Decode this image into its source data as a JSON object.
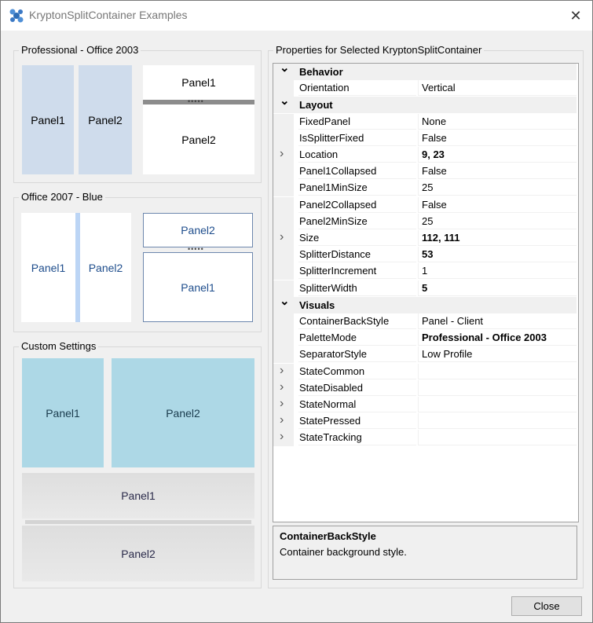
{
  "window": {
    "title": "KryptonSplitContainer Examples"
  },
  "groups": {
    "professional": {
      "title": "Professional - Office 2003",
      "vertical_panel1": "Panel1",
      "vertical_panel2": "Panel2",
      "horizontal_panel1": "Panel1",
      "horizontal_panel2": "Panel2"
    },
    "office2007": {
      "title": "Office 2007 - Blue",
      "vertical_panel1": "Panel1",
      "vertical_panel2": "Panel2",
      "horizontal_panel1": "Panel2",
      "horizontal_panel2": "Panel1"
    },
    "custom": {
      "title": "Custom Settings",
      "top_panel1": "Panel1",
      "top_panel2": "Panel2",
      "bottom_panel1": "Panel1",
      "bottom_panel2": "Panel2"
    },
    "properties": {
      "title": "Properties for Selected KryptonSplitContainer"
    }
  },
  "property_grid": {
    "rows": [
      {
        "kind": "category",
        "name": "Behavior"
      },
      {
        "kind": "prop",
        "name": "Orientation",
        "value": "Vertical",
        "bold": false,
        "expandable": false
      },
      {
        "kind": "category",
        "name": "Layout"
      },
      {
        "kind": "prop",
        "name": "FixedPanel",
        "value": "None",
        "bold": false,
        "expandable": false
      },
      {
        "kind": "prop",
        "name": "IsSplitterFixed",
        "value": "False",
        "bold": false,
        "expandable": false
      },
      {
        "kind": "prop",
        "name": "Location",
        "value": "9, 23",
        "bold": true,
        "expandable": true
      },
      {
        "kind": "prop",
        "name": "Panel1Collapsed",
        "value": "False",
        "bold": false,
        "expandable": false
      },
      {
        "kind": "prop",
        "name": "Panel1MinSize",
        "value": "25",
        "bold": false,
        "expandable": false
      },
      {
        "kind": "prop",
        "name": "Panel2Collapsed",
        "value": "False",
        "bold": false,
        "expandable": false
      },
      {
        "kind": "prop",
        "name": "Panel2MinSize",
        "value": "25",
        "bold": false,
        "expandable": false
      },
      {
        "kind": "prop",
        "name": "Size",
        "value": "112, 111",
        "bold": true,
        "expandable": true
      },
      {
        "kind": "prop",
        "name": "SplitterDistance",
        "value": "53",
        "bold": true,
        "expandable": false
      },
      {
        "kind": "prop",
        "name": "SplitterIncrement",
        "value": "1",
        "bold": false,
        "expandable": false
      },
      {
        "kind": "prop",
        "name": "SplitterWidth",
        "value": "5",
        "bold": true,
        "expandable": false
      },
      {
        "kind": "category",
        "name": "Visuals"
      },
      {
        "kind": "prop",
        "name": "ContainerBackStyle",
        "value": "Panel - Client",
        "bold": false,
        "expandable": false
      },
      {
        "kind": "prop",
        "name": "PaletteMode",
        "value": "Professional - Office 2003",
        "bold": true,
        "expandable": false
      },
      {
        "kind": "prop",
        "name": "SeparatorStyle",
        "value": "Low Profile",
        "bold": false,
        "expandable": false
      },
      {
        "kind": "prop",
        "name": "StateCommon",
        "value": "",
        "bold": false,
        "expandable": true
      },
      {
        "kind": "prop",
        "name": "StateDisabled",
        "value": "",
        "bold": false,
        "expandable": true
      },
      {
        "kind": "prop",
        "name": "StateNormal",
        "value": "",
        "bold": false,
        "expandable": true
      },
      {
        "kind": "prop",
        "name": "StatePressed",
        "value": "",
        "bold": false,
        "expandable": true
      },
      {
        "kind": "prop",
        "name": "StateTracking",
        "value": "",
        "bold": false,
        "expandable": true
      }
    ]
  },
  "description": {
    "title": "ContainerBackStyle",
    "text": "Container background style."
  },
  "buttons": {
    "close": "Close"
  },
  "colors": {
    "office2003_panel": "#cfdcec",
    "office2007_splitter": "#bcd5f5",
    "custom_panel": "#add8e6",
    "category_background": "#f0f0f0"
  }
}
